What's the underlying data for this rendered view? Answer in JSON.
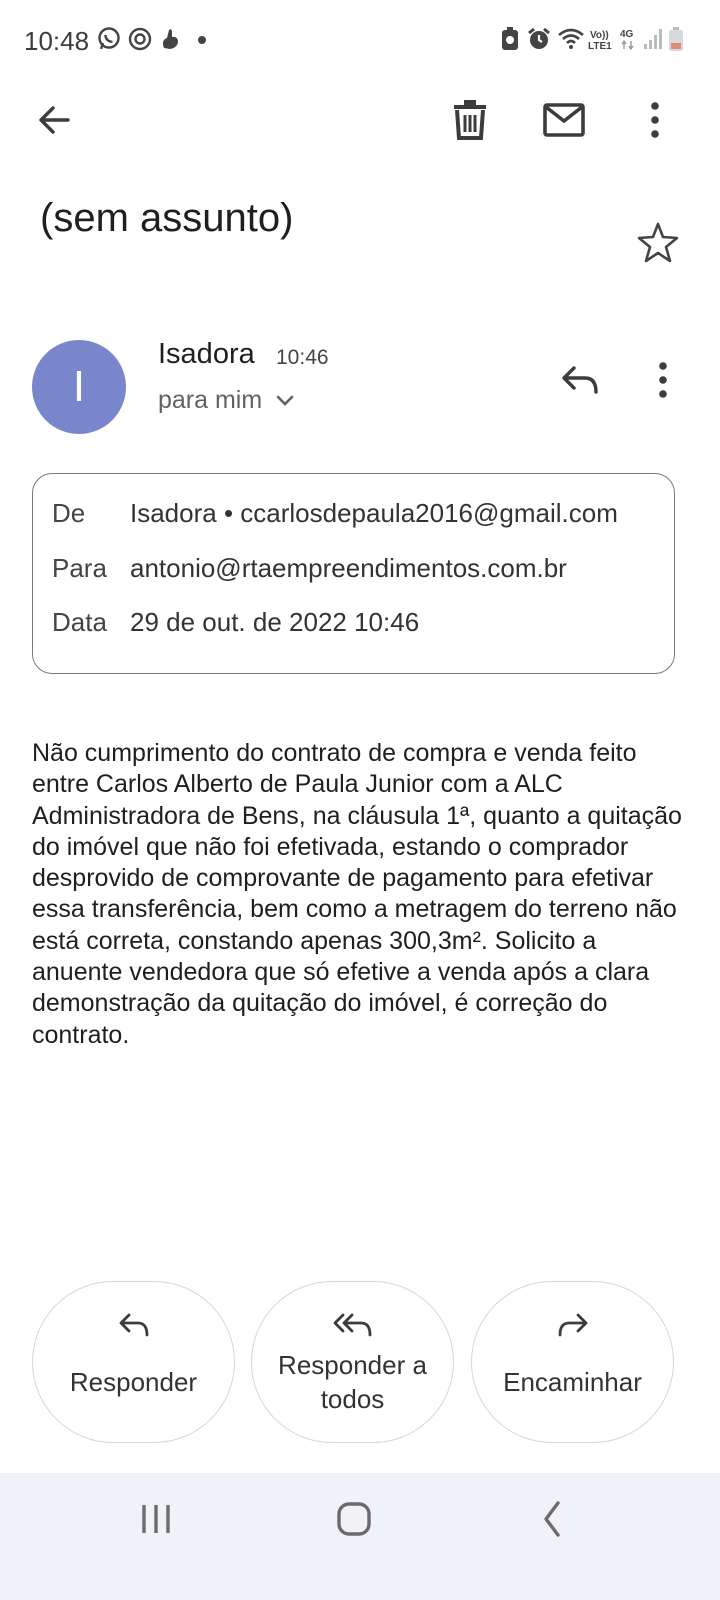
{
  "status_bar": {
    "time": "10:48",
    "volte": "Vo))",
    "lte": "LTE1",
    "network": "4G"
  },
  "toolbar": {
    "back_icon": "arrow-left-icon",
    "delete_icon": "trash-icon",
    "mark_unread_icon": "mail-icon",
    "more_icon": "more-vertical-icon"
  },
  "email": {
    "subject": "(sem assunto)",
    "sender": {
      "avatar_letter": "I",
      "avatar_color": "#7986cb",
      "name": "Isadora",
      "time": "10:46",
      "recipient_summary": "para mim"
    },
    "details": {
      "from_label": "De",
      "from_value": "Isadora • ccarlosdepaula2016@gmail.com",
      "to_label": "Para",
      "to_value": "antonio@rtaempreendimentos.com.br",
      "date_label": "Data",
      "date_value": "29 de out. de 2022 10:46"
    },
    "body": "Não cumprimento do contrato de compra e venda feito entre Carlos Alberto de Paula Junior com a ALC Administradora de Bens, na cláusula 1ª, quanto a quitação do imóvel que não foi efetivada, estando o comprador desprovido de comprovante de pagamento para efetivar essa transferência, bem como a metragem do terreno não está correta, constando apenas 300,3m². Solicito a anuente vendedora que só efetive a venda após a clara demonstração da quitação do imóvel, é correção do contrato."
  },
  "actions": {
    "reply": "Responder",
    "reply_all_line1": "Responder a",
    "reply_all_line2": "todos",
    "forward": "Encaminhar"
  }
}
